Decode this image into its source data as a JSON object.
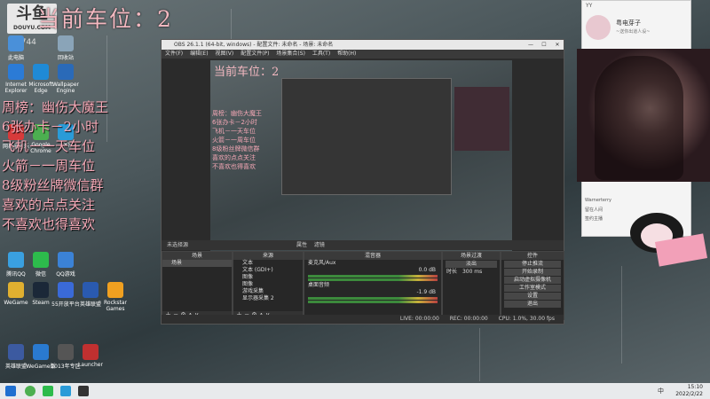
{
  "overlay": {
    "car_slot": "当前车位：2",
    "logo_text": "斗鱼",
    "logo_sub": "DOUYU.COM",
    "streamer_id": "9744",
    "list": [
      "周榜：幽伤大魔王",
      "6张办卡－2小时",
      "飞机－一天车位",
      "火箭－一周车位",
      "8级粉丝牌微信群",
      "喜欢的点点关注",
      "不喜欢也得喜欢"
    ]
  },
  "desktop": {
    "icons": [
      {
        "label": "此电脑",
        "color": "#4a90d9"
      },
      {
        "label": "回收站",
        "color": "#8aa4b8"
      },
      {
        "label": "Internet Explorer",
        "color": "#2b7bd6"
      },
      {
        "label": "Microsoft Edge",
        "color": "#1f8ad6"
      },
      {
        "label": "Wallpaper Engine",
        "color": "#2a6ab8"
      },
      {
        "label": "网易云音乐",
        "color": "#d83a3a"
      },
      {
        "label": "Google Chrome",
        "color": "#4caf50"
      },
      {
        "label": "QQ",
        "color": "#2a9bd8"
      },
      {
        "label": "腾讯QQ",
        "color": "#3aa0e0"
      },
      {
        "label": "微信",
        "color": "#2dbb4c"
      },
      {
        "label": "QQ游戏",
        "color": "#3b82d6"
      },
      {
        "label": "WeGame",
        "color": "#e0b030"
      },
      {
        "label": "Steam",
        "color": "#1b2838"
      },
      {
        "label": "55开放平台",
        "color": "#3a6ad8"
      },
      {
        "label": "英雄联盟",
        "color": "#2a5ab0"
      },
      {
        "label": "Rockstar Games",
        "color": "#f0a020"
      },
      {
        "label": "英雄联盟",
        "color": "#3c5aa0"
      },
      {
        "label": "WeGame版",
        "color": "#2a7ad0"
      },
      {
        "label": "2013年专区",
        "color": "#555"
      },
      {
        "label": "Launcher",
        "color": "#c03030"
      }
    ]
  },
  "obs": {
    "title": "OBS 26.1.1 (64-bit, windows) - 配置文件: 未命名 - 场景: 未命名",
    "menu": [
      "文件(F)",
      "编辑(E)",
      "视图(V)",
      "配置文件(P)",
      "场景集合(S)",
      "工具(T)",
      "帮助(H)"
    ],
    "preview_title": "当前车位：2",
    "preview_list": [
      "周榜：幽伤大魔王",
      "6张办卡－2小时",
      "飞机－一天车位",
      "火箭－一周车位",
      "8级粉丝牌微信群",
      "喜欢的点点关注",
      "不喜欢也得喜欢"
    ],
    "scene_bar": [
      "未选择源",
      "属性",
      "滤镜"
    ],
    "docks": {
      "scenes": {
        "title": "场景",
        "items": [
          "场景"
        ]
      },
      "sources": {
        "title": "来源",
        "items": [
          "文本",
          "文本 (GDI+)",
          "图像",
          "图像",
          "游戏采集",
          "显示器采集 2"
        ]
      },
      "mixer": {
        "title": "混音器",
        "items": [
          "麦克风/Aux",
          "桌面音频"
        ],
        "levels": [
          "0.0 dB",
          "-1.9 dB"
        ]
      },
      "transitions": {
        "title": "场景过渡",
        "type": "淡出",
        "duration_label": "时长",
        "duration": "300 ms"
      },
      "controls": {
        "title": "控件",
        "buttons": [
          "停止推流",
          "开始录制",
          "启动虚拟摄像机",
          "工作室模式",
          "设置",
          "退出"
        ]
      }
    },
    "status": {
      "live": "LIVE: 00:00:00",
      "rec": "REC: 00:00:00",
      "cpu": "CPU: 1.0%, 30.00 fps"
    }
  },
  "chat": {
    "header": "YY",
    "name": "粤电芽子",
    "sub": "~送你出道人设~",
    "rows": [
      "Warnerterry",
      "留在人间",
      "签约主播"
    ]
  },
  "taskbar": {
    "time": "15:10",
    "date": "2022/2/22",
    "tray": "中"
  }
}
